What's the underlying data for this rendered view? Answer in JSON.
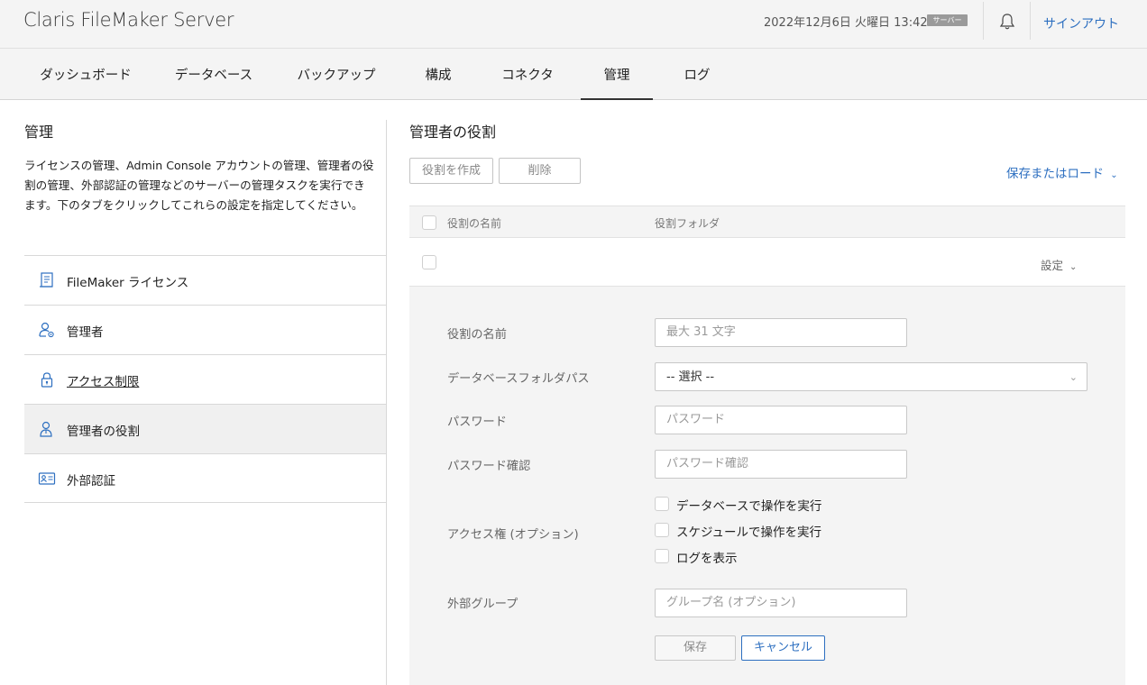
{
  "header": {
    "brand": "Claris FileMaker Server",
    "datetime": "2022年12月6日 火曜日 13:42",
    "server_badge": "サーバー",
    "signout": "サインアウト"
  },
  "nav": {
    "tabs": [
      {
        "label": "ダッシュボード"
      },
      {
        "label": "データベース"
      },
      {
        "label": "バックアップ"
      },
      {
        "label": "構成"
      },
      {
        "label": "コネクタ"
      },
      {
        "label": "管理"
      },
      {
        "label": "ログ"
      }
    ],
    "active": "管理"
  },
  "sidebar": {
    "title": "管理",
    "description": "ライセンスの管理、Admin Console アカウントの管理、管理者の役割の管理、外部認証の管理などのサーバーの管理タスクを実行できます。下のタブをクリックしてこれらの設定を指定してください。",
    "items": [
      {
        "label": "FileMaker ライセンス",
        "icon": "license-icon"
      },
      {
        "label": "管理者",
        "icon": "admin-user-icon"
      },
      {
        "label": "アクセス制限",
        "icon": "lock-icon"
      },
      {
        "label": "管理者の役割",
        "icon": "admin-role-icon"
      },
      {
        "label": "外部認証",
        "icon": "id-card-icon"
      }
    ],
    "active": "管理者の役割"
  },
  "main": {
    "title": "管理者の役割",
    "create_button": "役割を作成",
    "delete_button": "削除",
    "save_load": "保存またはロード",
    "table": {
      "columns": [
        "役割の名前",
        "役割フォルダ"
      ],
      "row_settings": "設定"
    },
    "form": {
      "role_name_label": "役割の名前",
      "role_name_placeholder": "最大 31 文字",
      "db_folder_label": "データベースフォルダパス",
      "db_folder_value": "-- 選択 --",
      "password_label": "パスワード",
      "password_placeholder": "パスワード",
      "password_confirm_label": "パスワード確認",
      "password_confirm_placeholder": "パスワード確認",
      "access_label": "アクセス権 (オプション)",
      "access_options": [
        {
          "label": "データベースで操作を実行",
          "checked": false
        },
        {
          "label": "スケジュールで操作を実行",
          "checked": false
        },
        {
          "label": "ログを表示",
          "checked": false
        }
      ],
      "external_group_label": "外部グループ",
      "external_group_placeholder": "グループ名 (オプション)",
      "save_button": "保存",
      "cancel_button": "キャンセル"
    }
  },
  "colors": {
    "accent_blue": "#2d6fc0",
    "panel_gray": "#f4f4f4",
    "badge_gray": "#9a9a9a"
  }
}
